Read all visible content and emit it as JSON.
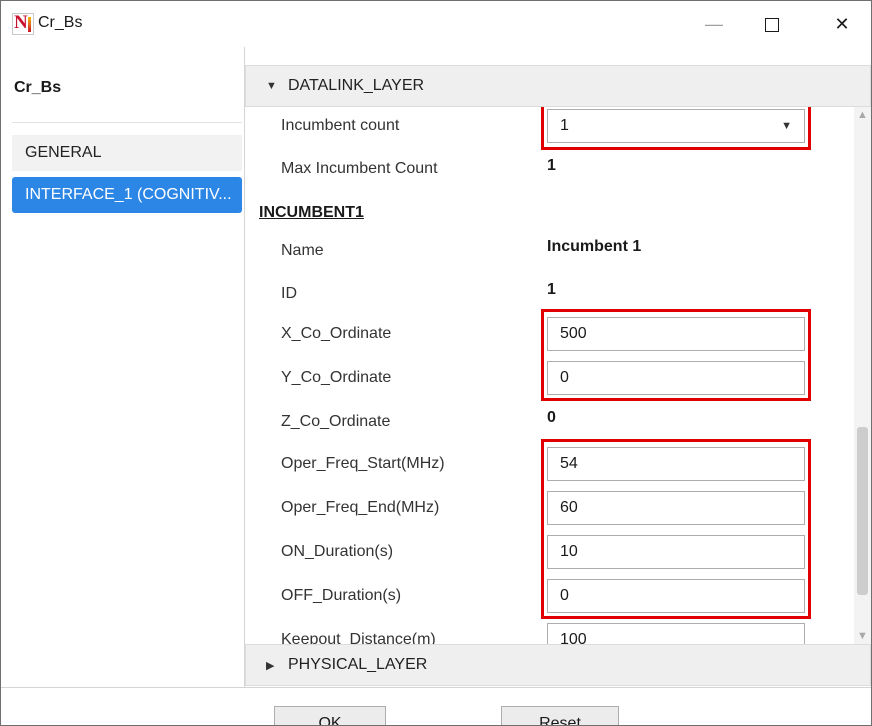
{
  "window": {
    "title": "Cr_Bs",
    "controls": {
      "minimize": "—",
      "maximize": "☐",
      "close": "✕"
    }
  },
  "sidebar": {
    "title": "Cr_Bs",
    "items": [
      {
        "label": "GENERAL",
        "selected": false
      },
      {
        "label": "INTERFACE_1 (COGNITIV...",
        "selected": true
      }
    ]
  },
  "sections": {
    "datalink": {
      "label": "DATALINK_LAYER",
      "expanded": true
    },
    "physical": {
      "label": "PHYSICAL_LAYER",
      "expanded": false
    }
  },
  "datalink": {
    "incumbent_count": {
      "label": "Incumbent count",
      "value": "1"
    },
    "max_incumbent_count": {
      "label": "Max Incumbent Count",
      "value": "1"
    },
    "group_title": "INCUMBENT1",
    "name": {
      "label": "Name",
      "value": "Incumbent 1"
    },
    "id": {
      "label": "ID",
      "value": "1"
    },
    "x_coordinate": {
      "label": "X_Co_Ordinate",
      "value": "500"
    },
    "y_coordinate": {
      "label": "Y_Co_Ordinate",
      "value": "0"
    },
    "z_coordinate": {
      "label": "Z_Co_Ordinate",
      "value": "0"
    },
    "oper_freq_start": {
      "label": "Oper_Freq_Start(MHz)",
      "value": "54"
    },
    "oper_freq_end": {
      "label": "Oper_Freq_End(MHz)",
      "value": "60"
    },
    "on_duration": {
      "label": "ON_Duration(s)",
      "value": "10"
    },
    "off_duration": {
      "label": "OFF_Duration(s)",
      "value": "0"
    },
    "keepout_distance": {
      "label": "Keepout_Distance(m)",
      "value": "100"
    }
  },
  "footer": {
    "ok_label": "OK",
    "reset_label": "Reset"
  },
  "colors": {
    "highlight": "#e00000",
    "selected": "#2b86e5",
    "brand_red": "#c8102e"
  },
  "icons": {
    "expanded": "caret-down-icon",
    "collapsed": "caret-right-icon",
    "dropdown": "chevron-down-icon",
    "scroll_up": "scroll-up-icon",
    "scroll_down": "scroll-down-icon"
  }
}
